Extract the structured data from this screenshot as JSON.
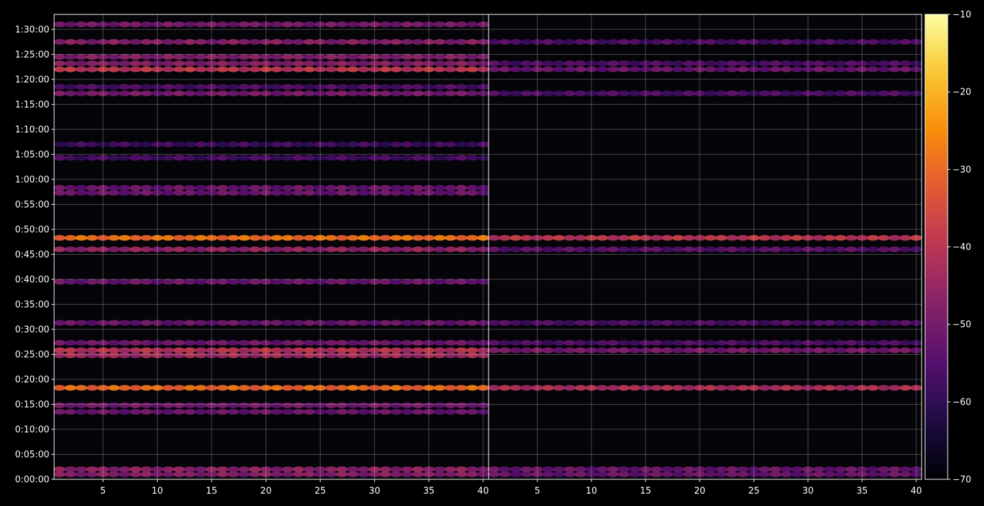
{
  "chart_data": {
    "type": "heatmap",
    "title": "",
    "xlabel": "",
    "ylabel": "",
    "grid": true,
    "colormap": "inferno",
    "background_color": "#050409",
    "panels": [
      {
        "id": "left",
        "x_ticks": [
          "5",
          "10",
          "15",
          "20",
          "25",
          "30",
          "35",
          "40"
        ],
        "xlim": [
          1,
          40
        ]
      },
      {
        "id": "right",
        "x_ticks": [
          "5",
          "10",
          "15",
          "20",
          "25",
          "30",
          "35",
          "40"
        ],
        "xlim": [
          1,
          40
        ]
      }
    ],
    "y_ticks": [
      "0:00:00",
      "0:05:00",
      "0:10:00",
      "0:15:00",
      "0:20:00",
      "0:25:00",
      "0:30:00",
      "0:35:00",
      "0:40:00",
      "0:45:00",
      "0:50:00",
      "0:55:00",
      "1:00:00",
      "1:05:00",
      "1:10:00",
      "1:15:00",
      "1:20:00",
      "1:25:00",
      "1:30:00"
    ],
    "ylim_minutes": [
      0,
      93
    ],
    "colorbar": {
      "ticks": [
        "−10",
        "−20",
        "−30",
        "−40",
        "−50",
        "−60",
        "−70"
      ],
      "range": [
        -70,
        -10
      ]
    },
    "bands_left": [
      {
        "t": 1.0,
        "v": -48
      },
      {
        "t": 2.0,
        "v": -47
      },
      {
        "t": 13.5,
        "v": -52
      },
      {
        "t": 14.8,
        "v": -51
      },
      {
        "t": 18.3,
        "v": -30
      },
      {
        "t": 24.8,
        "v": -44
      },
      {
        "t": 25.8,
        "v": -41
      },
      {
        "t": 27.3,
        "v": -51
      },
      {
        "t": 31.3,
        "v": -52
      },
      {
        "t": 39.5,
        "v": -52
      },
      {
        "t": 46.0,
        "v": -46
      },
      {
        "t": 48.3,
        "v": -29
      },
      {
        "t": 57.3,
        "v": -52
      },
      {
        "t": 58.3,
        "v": -52
      },
      {
        "t": 64.3,
        "v": -57
      },
      {
        "t": 67.0,
        "v": -58
      },
      {
        "t": 77.2,
        "v": -50
      },
      {
        "t": 78.5,
        "v": -56
      },
      {
        "t": 82.0,
        "v": -40
      },
      {
        "t": 83.2,
        "v": -48
      },
      {
        "t": 84.5,
        "v": -48
      },
      {
        "t": 87.5,
        "v": -48
      },
      {
        "t": 91.0,
        "v": -50
      }
    ],
    "bands_right": [
      {
        "t": 1.0,
        "v": -52
      },
      {
        "t": 2.0,
        "v": -52
      },
      {
        "t": 18.3,
        "v": -42
      },
      {
        "t": 25.8,
        "v": -50
      },
      {
        "t": 27.3,
        "v": -56
      },
      {
        "t": 31.3,
        "v": -56
      },
      {
        "t": 46.0,
        "v": -54
      },
      {
        "t": 48.3,
        "v": -40
      },
      {
        "t": 77.2,
        "v": -56
      },
      {
        "t": 82.0,
        "v": -52
      },
      {
        "t": 83.2,
        "v": -56
      },
      {
        "t": 87.5,
        "v": -56
      }
    ]
  }
}
